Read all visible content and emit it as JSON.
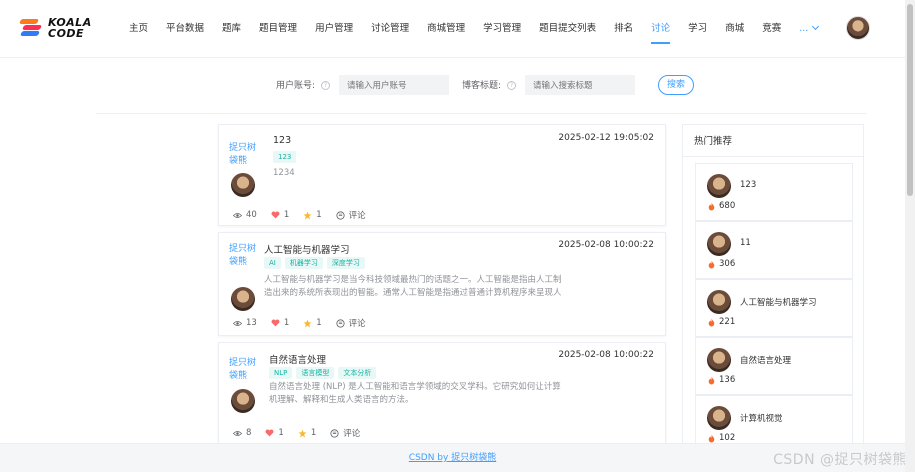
{
  "header": {
    "logo_text_line1": "KOALA",
    "logo_text_line2": "CODE",
    "nav": [
      {
        "label": "主页"
      },
      {
        "label": "平台数据"
      },
      {
        "label": "题库"
      },
      {
        "label": "题目管理"
      },
      {
        "label": "用户管理"
      },
      {
        "label": "讨论管理"
      },
      {
        "label": "商城管理"
      },
      {
        "label": "学习管理"
      },
      {
        "label": "题目提交列表"
      },
      {
        "label": "排名"
      },
      {
        "label": "讨论",
        "active": true
      },
      {
        "label": "学习"
      },
      {
        "label": "商城"
      },
      {
        "label": "竞赛"
      }
    ],
    "more_label": "..."
  },
  "search": {
    "user_label": "用户账号:",
    "user_placeholder": "请输入用户账号",
    "blog_label": "博客标题:",
    "blog_placeholder": "请输入搜索标题",
    "button_label": "搜索"
  },
  "posts": [
    {
      "author": "捉只树袋熊",
      "title": "123",
      "date": "2025-02-12 19:05:02",
      "tags": [
        "123"
      ],
      "desc": "1234",
      "views": "40",
      "likes": "1",
      "stars": "1",
      "comment_label": "评论"
    },
    {
      "author": "捉只树袋熊",
      "title": "人工智能与机器学习",
      "date": "2025-02-08 10:00:22",
      "tags": [
        "AI",
        "机器学习",
        "深度学习"
      ],
      "desc": "人工智能与机器学习是当今科技领域最热门的话题之一。人工智能是指由人工制造出来的系统所表现出的智能。通常人工智能是指通过普通计算机程序来呈现人类智",
      "views": "13",
      "likes": "1",
      "stars": "1",
      "comment_label": "评论"
    },
    {
      "author": "捉只树袋熊",
      "title": "自然语言处理",
      "date": "2025-02-08 10:00:22",
      "tags": [
        "NLP",
        "语言模型",
        "文本分析"
      ],
      "desc": "自然语言处理 (NLP) 是人工智能和语言学领域的交叉学科。它研究如何让计算机理解、解释和生成人类语言的方法。",
      "views": "8",
      "likes": "1",
      "stars": "1",
      "comment_label": "评论"
    }
  ],
  "hot": {
    "title": "热门推荐",
    "items": [
      {
        "name": "123",
        "count": "680"
      },
      {
        "name": "11",
        "count": "306"
      },
      {
        "name": "人工智能与机器学习",
        "count": "221"
      },
      {
        "name": "自然语言处理",
        "count": "136"
      },
      {
        "name": "计算机视觉",
        "count": "102"
      }
    ]
  },
  "footer": {
    "link_text": "CSDN by 捉只树袋熊"
  },
  "watermark": "CSDN @捉只树袋熊",
  "colors": {
    "accent": "#409eff",
    "tag_text": "#17b3a3",
    "tag_bg": "#e8f8f6",
    "heart": "#f56c6c",
    "star": "#f7ba2a",
    "fire": "#f56c2c"
  }
}
